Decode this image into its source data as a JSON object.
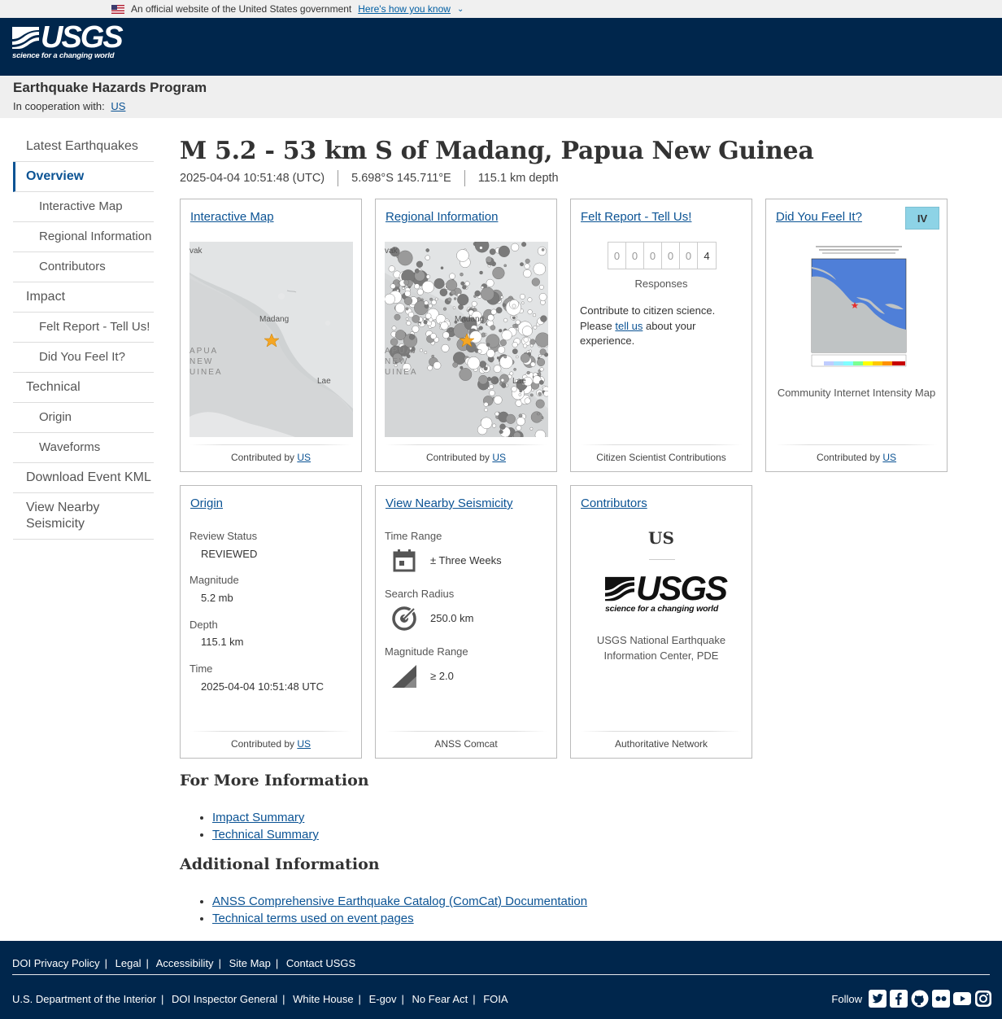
{
  "gov_banner": {
    "text": "An official website of the United States government",
    "link": "Here's how you know"
  },
  "header": {
    "logo_text": "USGS",
    "logo_tagline": "science for a changing world"
  },
  "program": {
    "title": "Earthquake Hazards Program",
    "coop_label": "In cooperation with:",
    "coop_link": "US"
  },
  "sidebar": {
    "items": [
      {
        "label": "Latest Earthquakes"
      },
      {
        "label": "Overview"
      },
      {
        "label": "Interactive Map"
      },
      {
        "label": "Regional Information"
      },
      {
        "label": "Contributors"
      },
      {
        "label": "Impact"
      },
      {
        "label": "Felt Report - Tell Us!"
      },
      {
        "label": "Did You Feel It?"
      },
      {
        "label": "Technical"
      },
      {
        "label": "Origin"
      },
      {
        "label": "Waveforms"
      },
      {
        "label": "Download Event KML"
      },
      {
        "label": "View Nearby Seismicity"
      }
    ]
  },
  "event": {
    "title": "M 5.2 - 53 km S of Madang, Papua New Guinea",
    "time": "2025-04-04 10:51:48 (UTC)",
    "location": "5.698°S 145.711°E",
    "depth": "115.1 km depth"
  },
  "cards": {
    "interactive_map": {
      "title": "Interactive Map",
      "footer_prefix": "Contributed by",
      "footer_link": "US",
      "labels": {
        "madang": "Madang",
        "lae": "Lae",
        "papua": "APUA",
        "new": "NEW",
        "guinea": "UINEA",
        "corner": "vak"
      }
    },
    "regional": {
      "title": "Regional Information",
      "footer_prefix": "Contributed by",
      "footer_link": "US"
    },
    "felt_report": {
      "title": "Felt Report - Tell Us!",
      "digits": [
        "0",
        "0",
        "0",
        "0",
        "0",
        "4"
      ],
      "responses": "Responses",
      "text_before": "Contribute to citizen science. Please",
      "text_link": "tell us",
      "text_after": "about your experience.",
      "footer": "Citizen Scientist Contributions"
    },
    "dyfi": {
      "title": "Did You Feel It?",
      "intensity": "IV",
      "caption": "Community Internet Intensity Map",
      "footer_prefix": "Contributed by",
      "footer_link": "US",
      "intensity_color": "#8dd3e6"
    },
    "origin": {
      "title": "Origin",
      "rows": [
        {
          "label": "Review Status",
          "value": "REVIEWED"
        },
        {
          "label": "Magnitude",
          "value": "5.2 mb"
        },
        {
          "label": "Depth",
          "value": "115.1 km"
        },
        {
          "label": "Time",
          "value": "2025-04-04 10:51:48 UTC"
        }
      ],
      "footer_prefix": "Contributed by",
      "footer_link": "US"
    },
    "seismicity": {
      "title": "View Nearby Seismicity",
      "rows": [
        {
          "label": "Time Range",
          "value": "± Three Weeks",
          "icon": "calendar-icon"
        },
        {
          "label": "Search Radius",
          "value": "250.0 km",
          "icon": "radius-icon"
        },
        {
          "label": "Magnitude Range",
          "value": "≥ 2.0",
          "icon": "magnitude-icon"
        }
      ],
      "footer": "ANSS Comcat"
    },
    "contributors": {
      "title": "Contributors",
      "code": "US",
      "name": "USGS National Earthquake Information Center, PDE",
      "footer": "Authoritative Network"
    }
  },
  "more_info": {
    "heading": "For More Information",
    "links": [
      "Impact Summary",
      "Technical Summary"
    ]
  },
  "additional_info": {
    "heading": "Additional Information",
    "links": [
      "ANSS Comprehensive Earthquake Catalog (ComCat) Documentation",
      "Technical terms used on event pages"
    ]
  },
  "footer": {
    "top_links": [
      "DOI Privacy Policy",
      "Legal",
      "Accessibility",
      "Site Map",
      "Contact USGS"
    ],
    "bottom_links": [
      "U.S. Department of the Interior",
      "DOI Inspector General",
      "White House",
      "E-gov",
      "No Fear Act",
      "FOIA"
    ],
    "follow": "Follow",
    "social_icons": [
      "twitter-icon",
      "facebook-icon",
      "github-icon",
      "flickr-icon",
      "youtube-icon",
      "instagram-icon"
    ]
  },
  "colors": {
    "header_bg": "#00264c",
    "link": "#0b5394",
    "intensity_iv": "#8dd3e6"
  }
}
